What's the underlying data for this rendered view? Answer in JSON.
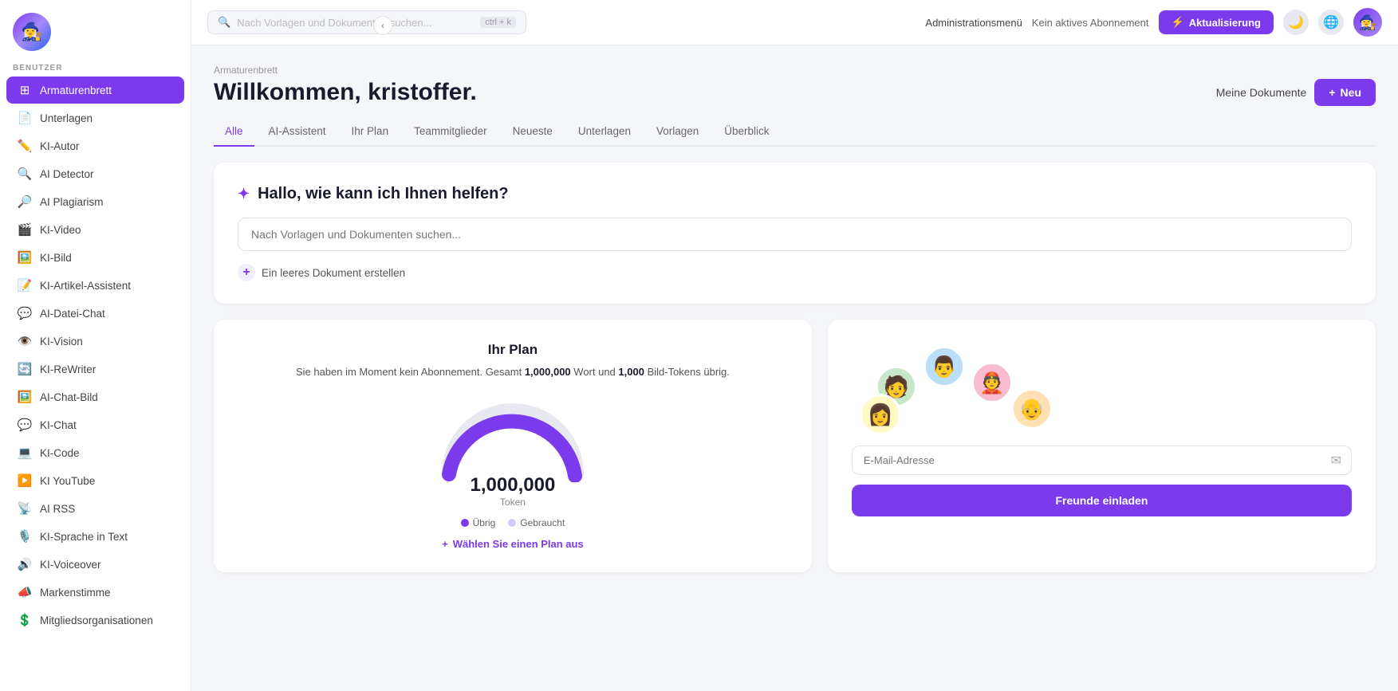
{
  "sidebar": {
    "label": "BENUTZER",
    "items": [
      {
        "id": "armaturenbrett",
        "label": "Armaturenbrett",
        "icon": "⊞",
        "active": true
      },
      {
        "id": "unterlagen",
        "label": "Unterlagen",
        "icon": "📄"
      },
      {
        "id": "ki-autor",
        "label": "KI-Autor",
        "icon": "✏️"
      },
      {
        "id": "ai-detector",
        "label": "AI Detector",
        "icon": "🔍"
      },
      {
        "id": "ai-plagiarism",
        "label": "AI Plagiarism",
        "icon": "🔎"
      },
      {
        "id": "ki-video",
        "label": "KI-Video",
        "icon": "🎬"
      },
      {
        "id": "ki-bild",
        "label": "KI-Bild",
        "icon": "🖼️"
      },
      {
        "id": "ki-artikel-assistent",
        "label": "KI-Artikel-Assistent",
        "icon": "📝"
      },
      {
        "id": "ai-datei-chat",
        "label": "AI-Datei-Chat",
        "icon": "💬"
      },
      {
        "id": "ki-vision",
        "label": "KI-Vision",
        "icon": "👁️"
      },
      {
        "id": "ki-rewriter",
        "label": "KI-ReWriter",
        "icon": "🔄"
      },
      {
        "id": "ai-chat-bild",
        "label": "AI-Chat-Bild",
        "icon": "🖼️"
      },
      {
        "id": "ki-chat",
        "label": "KI-Chat",
        "icon": "💬"
      },
      {
        "id": "ki-code",
        "label": "KI-Code",
        "icon": "💻"
      },
      {
        "id": "ki-youtube",
        "label": "KI YouTube",
        "icon": "▶️"
      },
      {
        "id": "ai-rss",
        "label": "AI RSS",
        "icon": "📡"
      },
      {
        "id": "ki-sprache",
        "label": "KI-Sprache in Text",
        "icon": "🎙️"
      },
      {
        "id": "ki-voiceover",
        "label": "KI-Voiceover",
        "icon": "🔊"
      },
      {
        "id": "markenstimme",
        "label": "Markenstimme",
        "icon": "📣"
      },
      {
        "id": "mitglieds",
        "label": "Mitgliedsorganisationen",
        "icon": "💲"
      }
    ]
  },
  "topbar": {
    "search_placeholder": "Nach Vorlagen und Dokumenten suchen...",
    "search_shortcut": "ctrl + k",
    "admin_label": "Administrationsmenü",
    "plan_label": "Kein aktives Abonnement",
    "upgrade_label": "Aktualisierung"
  },
  "header": {
    "breadcrumb": "Armaturenbrett",
    "title": "Willkommen, kristoffer.",
    "my_docs_label": "Meine Dokumente",
    "new_label": "Neu"
  },
  "tabs": [
    {
      "id": "alle",
      "label": "Alle",
      "active": true
    },
    {
      "id": "ai-assistent",
      "label": "AI-Assistent"
    },
    {
      "id": "ihr-plan",
      "label": "Ihr Plan"
    },
    {
      "id": "teammitglieder",
      "label": "Teammitglieder"
    },
    {
      "id": "neueste",
      "label": "Neueste"
    },
    {
      "id": "unterlagen",
      "label": "Unterlagen"
    },
    {
      "id": "vorlagen",
      "label": "Vorlagen"
    },
    {
      "id": "ueberblick",
      "label": "Überblick"
    }
  ],
  "assistant": {
    "title": "Hallo, wie kann ich Ihnen helfen?",
    "search_placeholder": "Nach Vorlagen und Dokumenten suchen...",
    "create_blank_label": "Ein leeres Dokument erstellen"
  },
  "plan": {
    "title": "Ihr Plan",
    "description_start": "Sie haben im Moment kein Abonnement. Gesamt ",
    "words": "1,000,000",
    "description_mid": " Wort und ",
    "tokens": "1,000",
    "description_end": " Bild-Tokens übrig.",
    "gauge_value": "1,000,000",
    "gauge_label": "Token",
    "legend_remaining": "Übrig",
    "legend_used": "Gebraucht",
    "select_plan_label": "Wählen Sie einen Plan aus"
  },
  "invite": {
    "email_placeholder": "E-Mail-Adresse",
    "button_label": "Freunde einladen"
  },
  "colors": {
    "primary": "#7c3aed",
    "gauge_fill": "#7c3aed",
    "gauge_bg": "#e8e8f0"
  }
}
